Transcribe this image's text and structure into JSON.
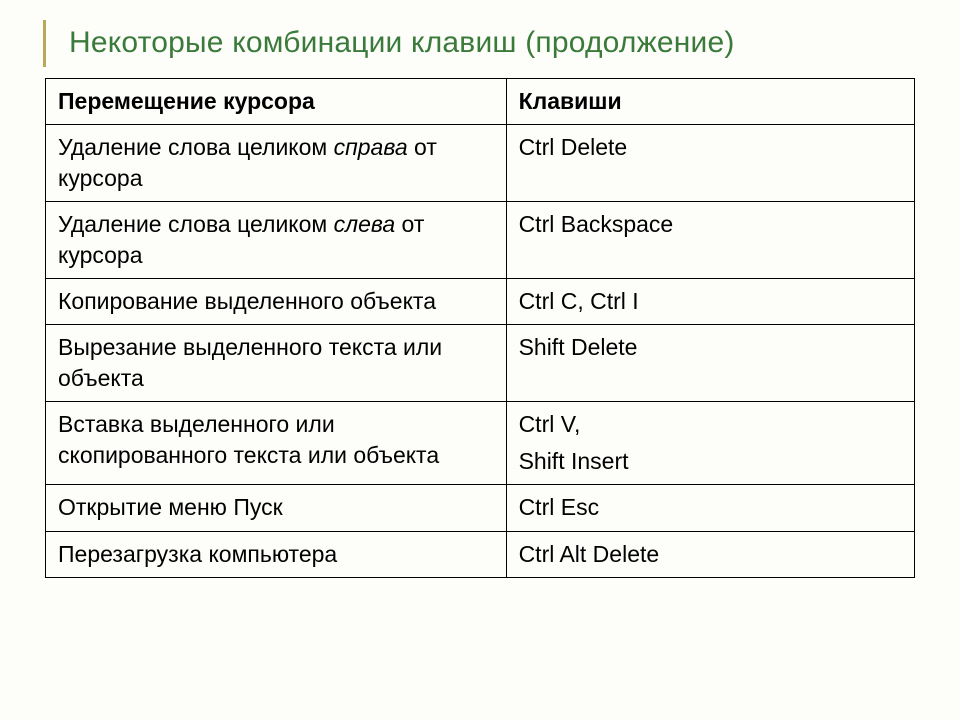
{
  "title": "Некоторые комбинации клавиш (продолжение)",
  "headers": {
    "col1": "Перемещение курсора",
    "col2": "Клавиши"
  },
  "rows": [
    {
      "desc_pre": "Удаление слова целиком ",
      "desc_italic": "справа",
      "desc_post": " от курсора",
      "keys": "Ctrl   Delete"
    },
    {
      "desc_pre": "Удаление слова целиком ",
      "desc_italic": "слева",
      "desc_post": " от курсора",
      "keys": "Ctrl   Backspace"
    },
    {
      "desc_pre": "Копирование выделенного объекта",
      "desc_italic": "",
      "desc_post": "",
      "keys": "Ctrl  C,    Ctrl  I"
    },
    {
      "desc_pre": "Вырезание выделенного текста или объекта",
      "desc_italic": "",
      "desc_post": "",
      "keys": "Shift  Delete"
    },
    {
      "desc_pre": "Вставка выделенного или скопированного текста или объекта",
      "desc_italic": "",
      "desc_post": "",
      "keys": "Ctrl  V,",
      "keys2": "Shift  Insert"
    },
    {
      "desc_pre": "Открытие меню Пуск",
      "desc_italic": "",
      "desc_post": "",
      "keys": "Ctrl  Esc"
    },
    {
      "desc_pre": "Перезагрузка компьютера",
      "desc_italic": "",
      "desc_post": "",
      "keys": "Ctrl Alt Delete"
    }
  ]
}
